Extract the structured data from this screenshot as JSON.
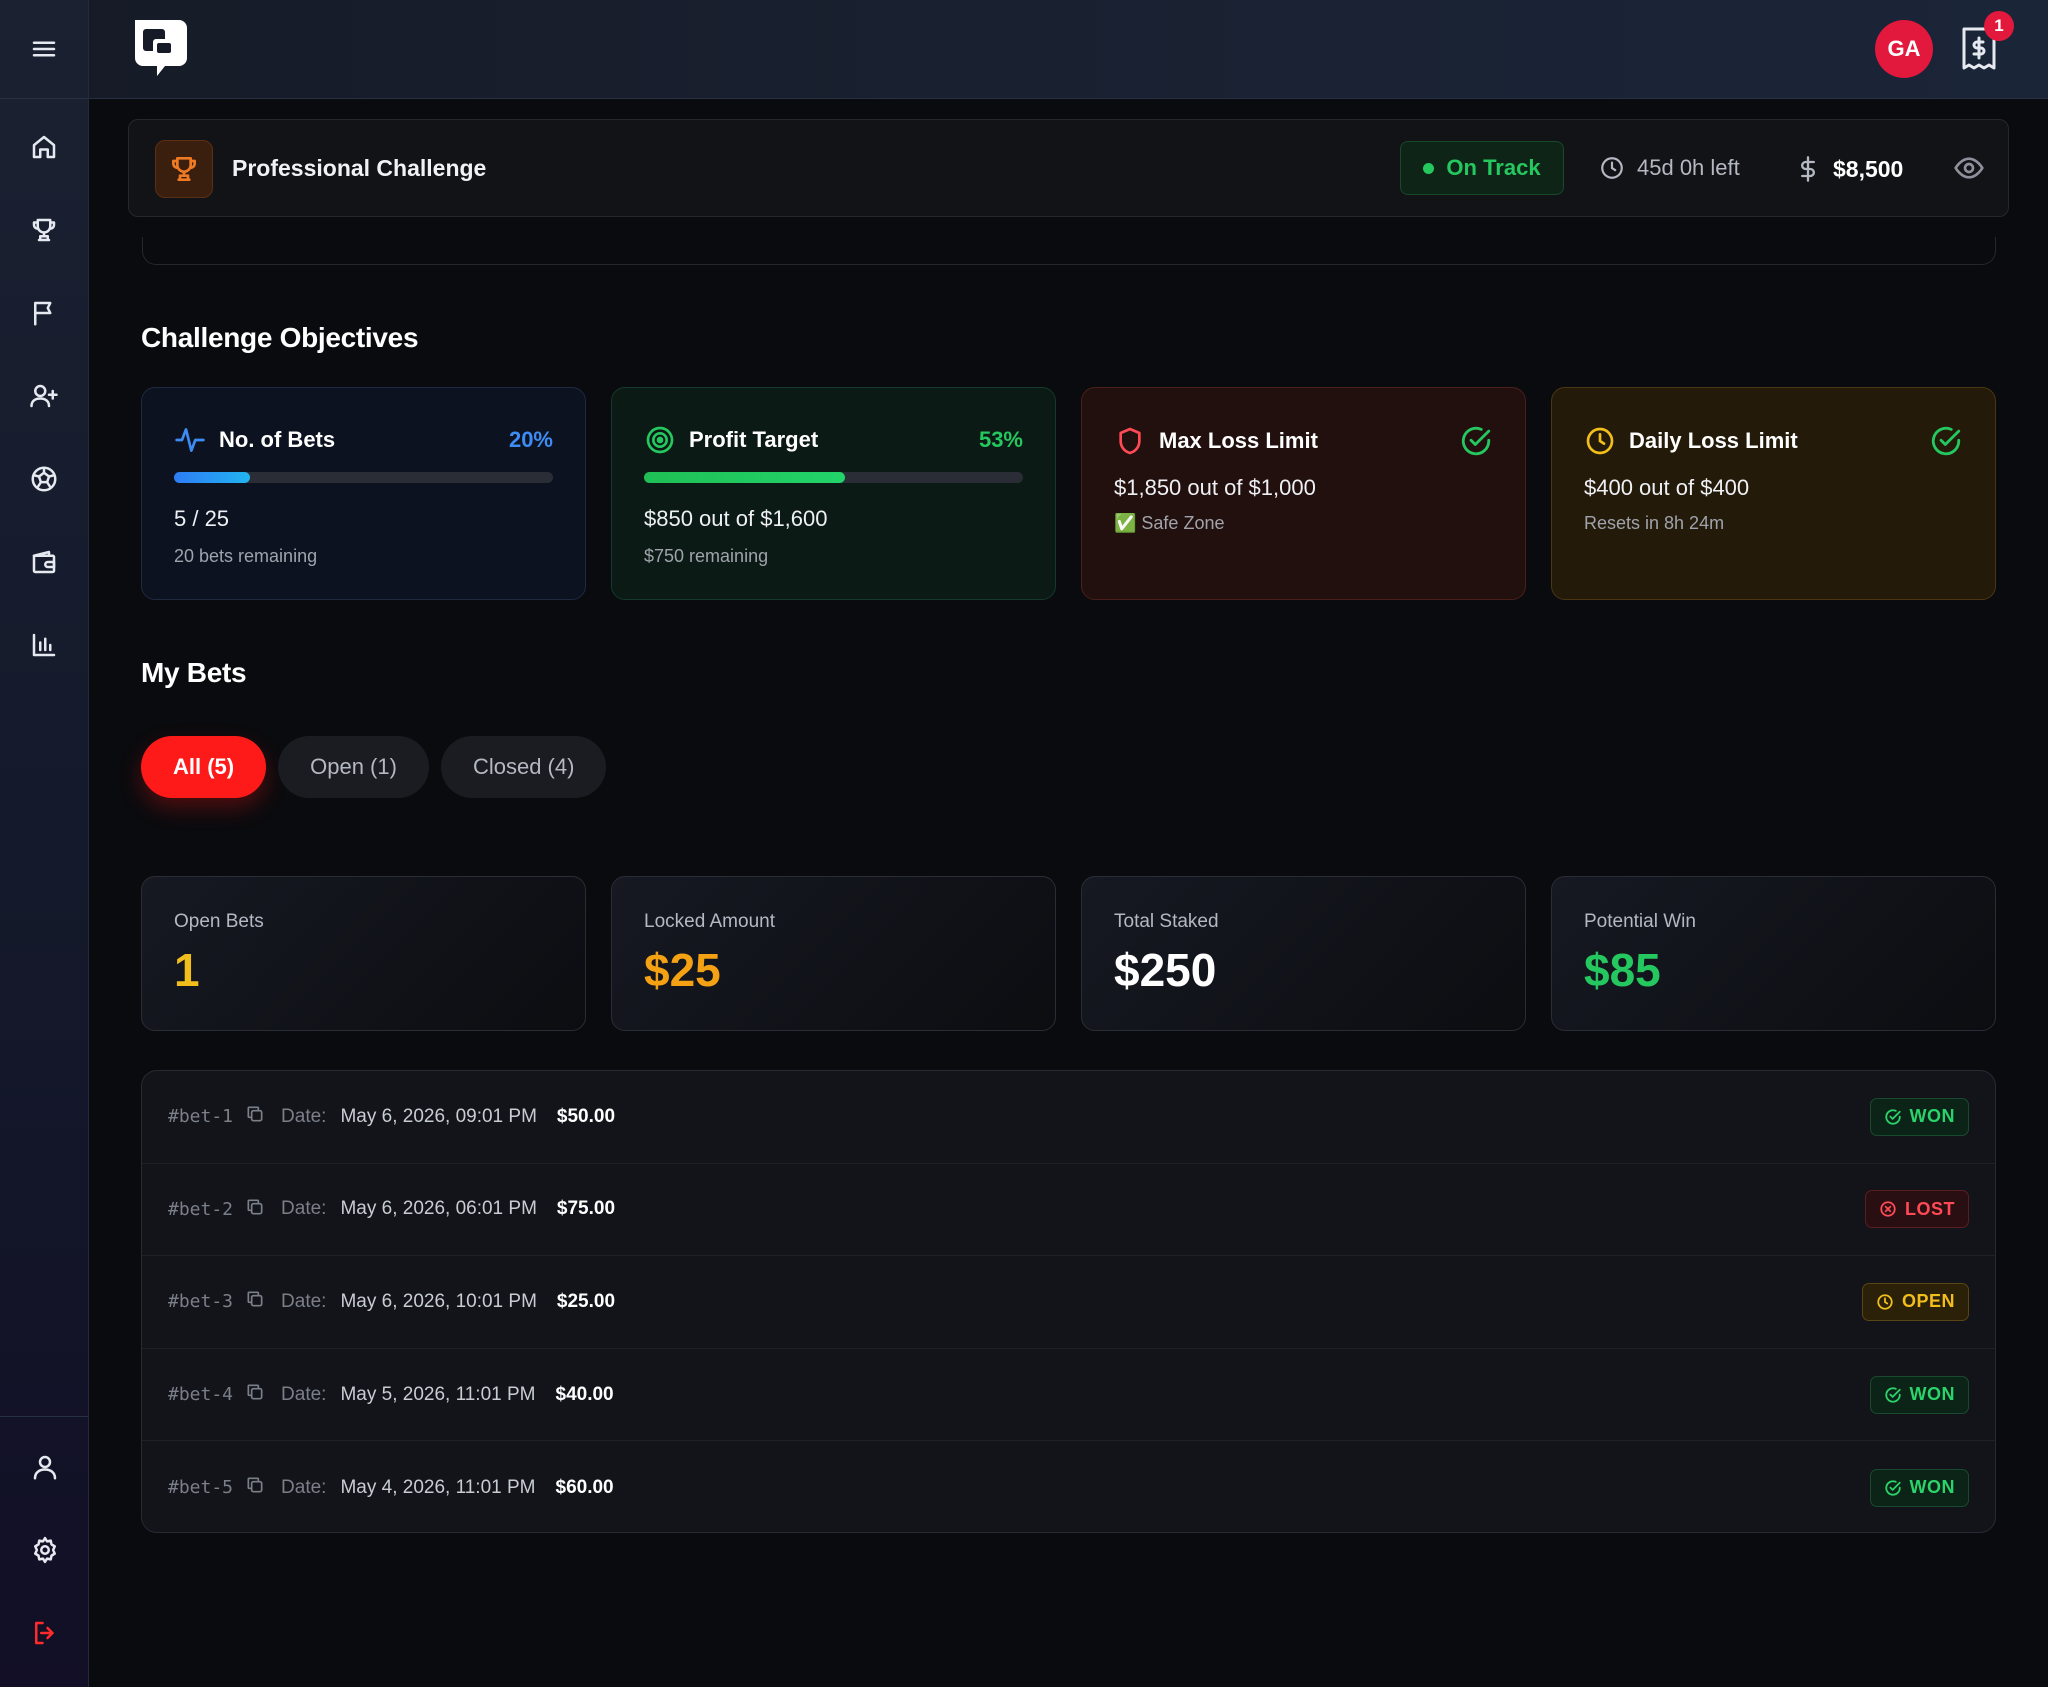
{
  "header": {
    "avatar_initials": "GA",
    "notification_count": "1"
  },
  "challenge": {
    "title": "Professional Challenge",
    "status": "On Track",
    "time_left": "45d 0h left",
    "balance": "$8,500"
  },
  "objectives": {
    "section_title": "Challenge Objectives",
    "cards": [
      {
        "title": "No. of Bets",
        "percent": "20%",
        "progress": 0.2,
        "main": "5 / 25",
        "sub": "20 bets remaining"
      },
      {
        "title": "Profit Target",
        "percent": "53%",
        "progress": 0.53,
        "main": "$850 out of $1,600",
        "sub": "$750 remaining"
      },
      {
        "title": "Max Loss Limit",
        "main": "$1,850 out of $1,000",
        "sub": "✅ Safe Zone"
      },
      {
        "title": "Daily Loss Limit",
        "main": "$400 out of $400",
        "sub": "Resets in 8h 24m"
      }
    ]
  },
  "my_bets": {
    "section_title": "My Bets",
    "tabs": [
      "All (5)",
      "Open (1)",
      "Closed (4)"
    ],
    "stats": [
      {
        "label": "Open Bets",
        "value": "1"
      },
      {
        "label": "Locked Amount",
        "value": "$25"
      },
      {
        "label": "Total Staked",
        "value": "$250"
      },
      {
        "label": "Potential Win",
        "value": "$85"
      }
    ],
    "date_label": "Date:",
    "rows": [
      {
        "id": "#bet-1",
        "date": "May 6, 2026, 09:01 PM",
        "amount": "$50.00",
        "status": "WON"
      },
      {
        "id": "#bet-2",
        "date": "May 6, 2026, 06:01 PM",
        "amount": "$75.00",
        "status": "LOST"
      },
      {
        "id": "#bet-3",
        "date": "May 6, 2026, 10:01 PM",
        "amount": "$25.00",
        "status": "OPEN"
      },
      {
        "id": "#bet-4",
        "date": "May 5, 2026, 11:01 PM",
        "amount": "$40.00",
        "status": "WON"
      },
      {
        "id": "#bet-5",
        "date": "May 4, 2026, 11:01 PM",
        "amount": "$60.00",
        "status": "WON"
      }
    ]
  },
  "colors": {
    "accent_red": "#ff1a1a",
    "success": "#25c75f",
    "info": "#3d8cf5",
    "warning": "#f5a114",
    "danger": "#ff4a55"
  },
  "icons": {
    "sidebar": [
      "menu-icon",
      "home-icon",
      "trophy-icon",
      "flag-icon",
      "user-plus-icon",
      "football-icon",
      "wallet-icon",
      "bar-chart-icon"
    ],
    "sidebar_bottom": [
      "user-icon",
      "gear-icon",
      "logout-icon"
    ]
  }
}
